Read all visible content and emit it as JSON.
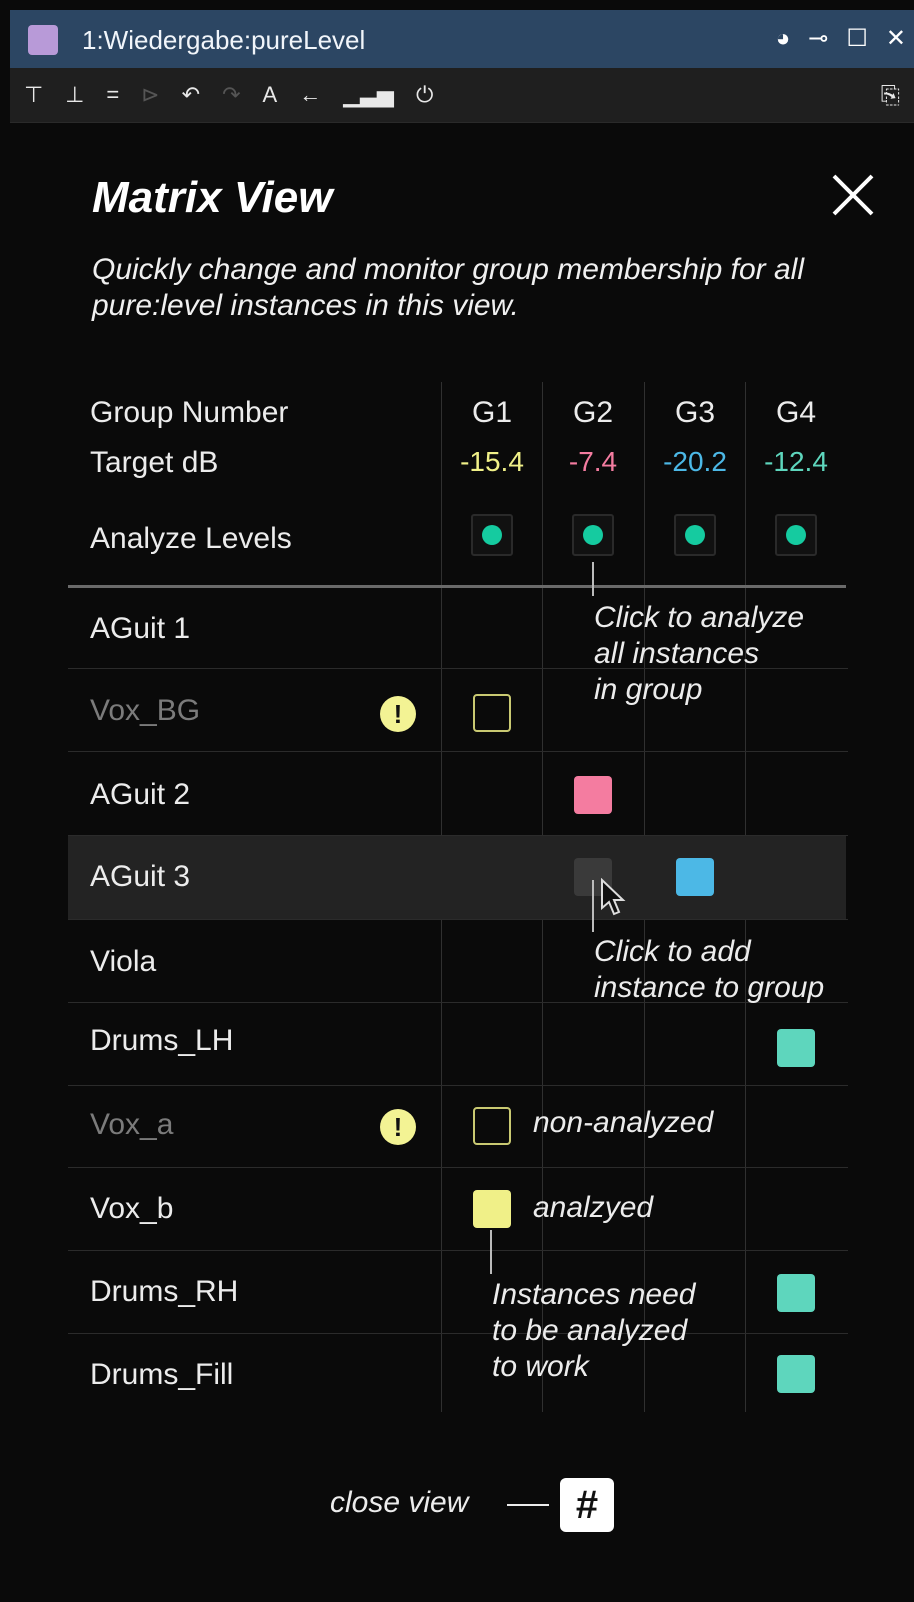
{
  "window": {
    "title": "1:Wiedergabe:pureLevel",
    "app_swatch_color": "#b89ad8",
    "controls": [
      "pie-chart-icon",
      "pin-icon",
      "maximize-icon",
      "close-icon"
    ]
  },
  "toolbar": {
    "tools": [
      "insert-top-icon",
      "insert-fx-icon",
      "equals-icon",
      "link-icon",
      "undo-icon",
      "redo-icon",
      "font-a-icon",
      "back-arrow-icon",
      "bar-meter-icon",
      "power-icon"
    ],
    "right_tool": "document-icon"
  },
  "matrix_view": {
    "title": "Matrix View",
    "description": "Quickly change and monitor group membership for all pure:level instances in this view.",
    "close_icon": "close-icon",
    "group_number_label": "Group Number",
    "target_db_label": "Target dB",
    "analyze_levels_label": "Analyze Levels",
    "groups": [
      {
        "name": "G1",
        "target_db": "-15.4",
        "color": "#f0f088"
      },
      {
        "name": "G2",
        "target_db": "-7.4",
        "color": "#f47ca0"
      },
      {
        "name": "G3",
        "target_db": "-20.2",
        "color": "#4cb8e6"
      },
      {
        "name": "G4",
        "target_db": "-12.4",
        "color": "#5ed6bd"
      }
    ],
    "instances": [
      {
        "name": "AGuit 1",
        "analyzed": true,
        "group": null
      },
      {
        "name": "Vox_BG",
        "analyzed": false,
        "group": "G1"
      },
      {
        "name": "AGuit 2",
        "analyzed": true,
        "group": "G2"
      },
      {
        "name": "AGuit 3",
        "analyzed": true,
        "group": "G3",
        "highlighted": true
      },
      {
        "name": "Viola",
        "analyzed": true,
        "group": null
      },
      {
        "name": "Drums_LH",
        "analyzed": true,
        "group": "G4"
      },
      {
        "name": "Vox_a",
        "analyzed": false,
        "group": "G1"
      },
      {
        "name": "Vox_b",
        "analyzed": true,
        "group": "G1"
      },
      {
        "name": "Drums_RH",
        "analyzed": true,
        "group": "G4"
      },
      {
        "name": "Drums_Fill",
        "analyzed": true,
        "group": "G4"
      }
    ],
    "warning_symbol": "!",
    "annotations": {
      "analyze": [
        "Click to analyze",
        "all instances",
        "in group"
      ],
      "add": [
        "Click to add",
        "instance to group"
      ],
      "non_analyzed": "non-analyzed",
      "analyzed": "analzyed",
      "need_analyze": [
        "Instances need",
        "to be analyzed",
        "to work"
      ]
    },
    "footer": {
      "close_label": "close view",
      "grid_glyph": "#"
    }
  }
}
